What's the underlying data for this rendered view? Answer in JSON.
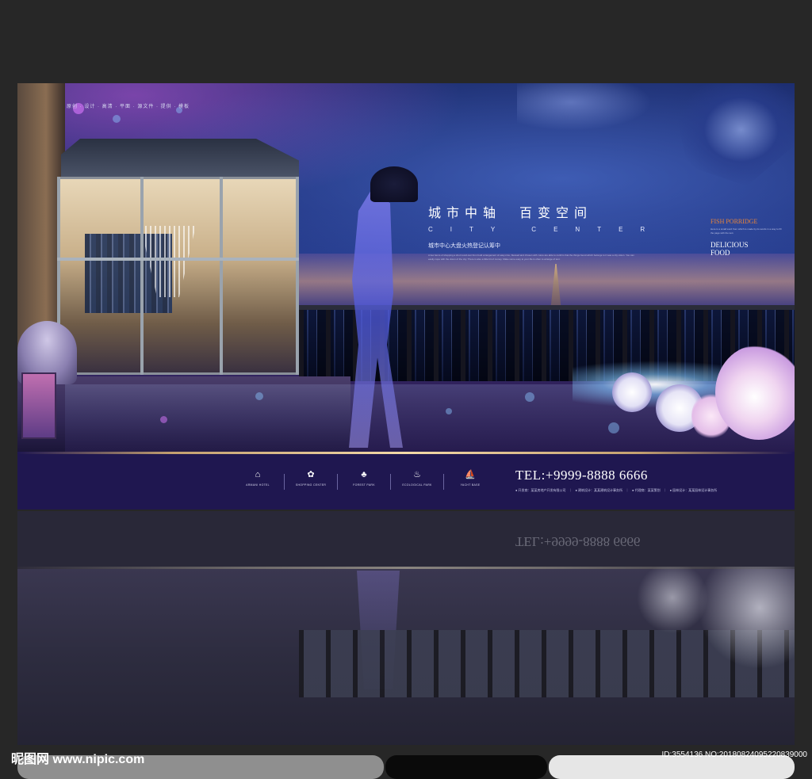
{
  "banner": {
    "tagline_top": "原创 · 设计 · 高清 · 平面 · 源文件 · 提供 · 模板",
    "headline_zh": "城市中轴　百变空间",
    "headline_en": "CITY CENTER",
    "sub_zh": "城市中心大盘火热登记认筹中",
    "body_copy": "A few items of shopping a short word-text from bold arrangement of easy-nice, blessed and chosen with. Here are able to confirm that the things found which belongs to it was a city vision. You can easily cope with the vision of the city. There is also a little bit of money. Make some easy to your life is often to arrange of text.",
    "side": {
      "title": "FISH PORRIDGE",
      "small": "Here is a small word from which is made by its words in a way to fill the page with the text.",
      "big": "DELICIOUS FOOD"
    }
  },
  "footer": {
    "icons": [
      {
        "icon": "hotel-icon",
        "glyph": "⌂",
        "label": "ARMANI HOTEL"
      },
      {
        "icon": "shopping-icon",
        "glyph": "✿",
        "label": "SHOPPING CENTER"
      },
      {
        "icon": "forest-icon",
        "glyph": "♣",
        "label": "FOREST PARK"
      },
      {
        "icon": "ecological-icon",
        "glyph": "♨",
        "label": "ECOLOGICAL PARK"
      },
      {
        "icon": "yacht-icon",
        "glyph": "⛵",
        "label": "YACHT BASE"
      }
    ],
    "tel": "TEL:+9999-8888 6666",
    "info": "● 开发商：某某房地产开发有限公司　｜　● 建筑设计：某某建筑设计事务所　｜　● 代理商：某某策划　｜　● 园林设计：某某园林设计事务所"
  },
  "watermark": {
    "logo": "昵图网 www.nipic.com",
    "id": "ID:3554136 NO:20180824095220839000"
  },
  "colors": {
    "page_bg": "#272727",
    "footer_bg": "#1f1750",
    "accent_orange": "#e8843a"
  }
}
